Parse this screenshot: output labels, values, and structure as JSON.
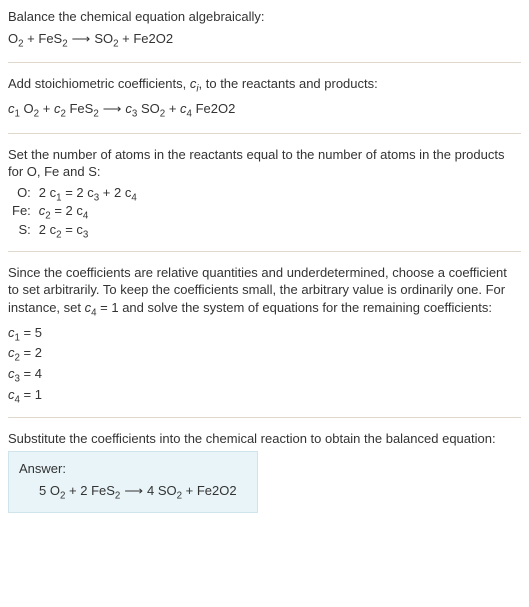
{
  "section1": {
    "intro": "Balance the chemical equation algebraically:",
    "eq_left1": "O",
    "eq_left1_sub": "2",
    "eq_plus1": " + FeS",
    "eq_left2_sub": "2",
    "arrow": " ⟶ ",
    "eq_right1": "SO",
    "eq_right1_sub": "2",
    "eq_plus2": " + Fe2O2"
  },
  "section2": {
    "intro_a": "Add stoichiometric coefficients, ",
    "ci": "c",
    "ci_sub": "i",
    "intro_b": ", to the reactants and products:",
    "c1": "c",
    "c1s": "1",
    "sp1": " O",
    "sp1s": "2",
    "plus1": " + ",
    "c2": "c",
    "c2s": "2",
    "sp2": " FeS",
    "sp2s": "2",
    "arrow": " ⟶ ",
    "c3": "c",
    "c3s": "3",
    "sp3": " SO",
    "sp3s": "2",
    "plus2": " + ",
    "c4": "c",
    "c4s": "4",
    "sp4": " Fe2O2"
  },
  "section3": {
    "intro": "Set the number of atoms in the reactants equal to the number of atoms in the products for O, Fe and S:",
    "rows": [
      {
        "el": "O:",
        "lhs_a": "2 c",
        "lhs_as": "1",
        "eq": " = 2 c",
        "rhs_as": "3",
        "mid": " + 2 c",
        "rhs_bs": "4"
      },
      {
        "el": "Fe:",
        "lhs_a": "c",
        "lhs_as": "2",
        "eq": " = 2 c",
        "rhs_as": "4",
        "mid": "",
        "rhs_bs": ""
      },
      {
        "el": "S:",
        "lhs_a": "2 c",
        "lhs_as": "2",
        "eq": " = c",
        "rhs_as": "3",
        "mid": "",
        "rhs_bs": ""
      }
    ]
  },
  "section4": {
    "intro_a": "Since the coefficients are relative quantities and underdetermined, choose a coefficient to set arbitrarily. To keep the coefficients small, the arbitrary value is ordinarily one. For instance, set ",
    "cvar": "c",
    "cvars": "4",
    "intro_b": " = 1 and solve the system of equations for the remaining coefficients:",
    "line1_a": "c",
    "line1_as": "1",
    "line1_b": " = 5",
    "line2_a": "c",
    "line2_as": "2",
    "line2_b": " = 2",
    "line3_a": "c",
    "line3_as": "3",
    "line3_b": " = 4",
    "line4_a": "c",
    "line4_as": "4",
    "line4_b": " = 1"
  },
  "section5": {
    "intro": "Substitute the coefficients into the chemical reaction to obtain the balanced equation:",
    "answer_label": "Answer:",
    "eq_a": "5 O",
    "eq_as": "2",
    "eq_b": " + 2 FeS",
    "eq_bs": "2",
    "arrow": " ⟶ ",
    "eq_c": "4 SO",
    "eq_cs": "2",
    "eq_d": " + Fe2O2"
  }
}
